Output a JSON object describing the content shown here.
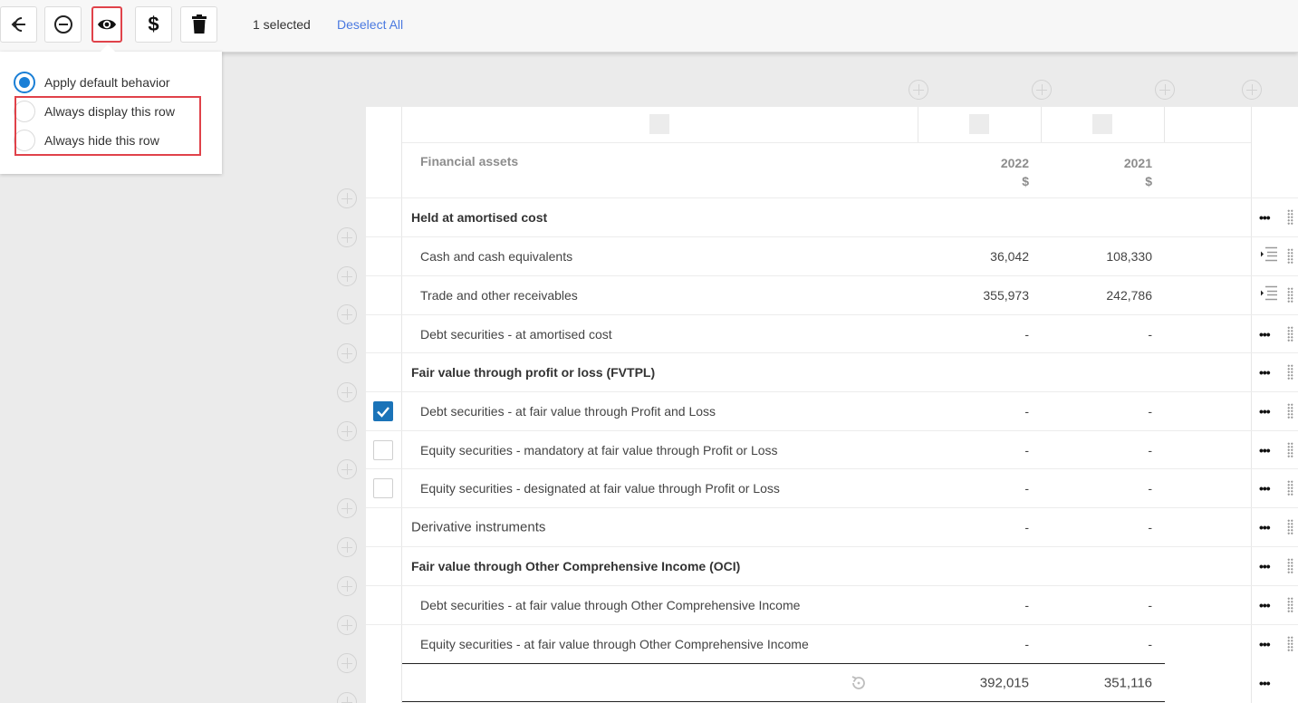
{
  "toolbar": {
    "buttons": [
      {
        "name": "indent-icon"
      },
      {
        "name": "minus-circle-icon"
      },
      {
        "name": "eye-icon"
      },
      {
        "name": "dollar-icon"
      },
      {
        "name": "trash-icon"
      }
    ],
    "selected_text": "1 selected",
    "deselect_label": "Deselect All",
    "highlight_color": "#e0424a",
    "link_color": "#4a79e0"
  },
  "visibility_menu": {
    "options": [
      {
        "label": "Apply default behavior",
        "selected": true
      },
      {
        "label": "Always display this row",
        "selected": false
      },
      {
        "label": "Always hide this row",
        "selected": false
      }
    ]
  },
  "table": {
    "header": {
      "title": "Financial assets",
      "col1_year": "2022",
      "col1_unit": "$",
      "col2_year": "2021",
      "col2_unit": "$"
    },
    "rows": [
      {
        "label": "Held at amortised cost",
        "style": "bold",
        "v1": "",
        "v2": "",
        "checkbox": null,
        "action": "dots"
      },
      {
        "label": "Cash and cash equivalents",
        "style": "sub",
        "v1": "36,042",
        "v2": "108,330",
        "checkbox": null,
        "action": "indent"
      },
      {
        "label": "Trade and other receivables",
        "style": "sub",
        "v1": "355,973",
        "v2": "242,786",
        "checkbox": null,
        "action": "indent"
      },
      {
        "label": "Debt securities - at amortised cost",
        "style": "sub",
        "v1": "-",
        "v2": "-",
        "checkbox": null,
        "action": "dots"
      },
      {
        "label": "Fair value through profit or loss (FVTPL)",
        "style": "bold",
        "v1": "",
        "v2": "",
        "checkbox": null,
        "action": "dots"
      },
      {
        "label": "Debt securities - at fair value through Profit and Loss",
        "style": "sub",
        "v1": "-",
        "v2": "-",
        "checkbox": "checked",
        "action": "dots"
      },
      {
        "label": "Equity securities - mandatory at fair value through Profit or Loss",
        "style": "sub",
        "v1": "-",
        "v2": "-",
        "checkbox": "unchecked",
        "action": "dots"
      },
      {
        "label": "Equity securities - designated at fair value through Profit or Loss",
        "style": "sub",
        "v1": "-",
        "v2": "-",
        "checkbox": "unchecked",
        "action": "dots"
      },
      {
        "label": "Derivative instruments",
        "style": "plain",
        "v1": "-",
        "v2": "-",
        "checkbox": null,
        "action": "dots"
      },
      {
        "label": "Fair value through Other Comprehensive Income (OCI)",
        "style": "bold",
        "v1": "",
        "v2": "",
        "checkbox": null,
        "action": "dots"
      },
      {
        "label": "Debt securities - at fair value through Other Comprehensive Income",
        "style": "sub",
        "v1": "-",
        "v2": "-",
        "checkbox": null,
        "action": "dots"
      },
      {
        "label": "Equity securities - at fair value through Other Comprehensive Income",
        "style": "sub",
        "v1": "-",
        "v2": "-",
        "checkbox": null,
        "action": "dots"
      }
    ],
    "total": {
      "v1": "392,015",
      "v2": "351,116"
    }
  }
}
